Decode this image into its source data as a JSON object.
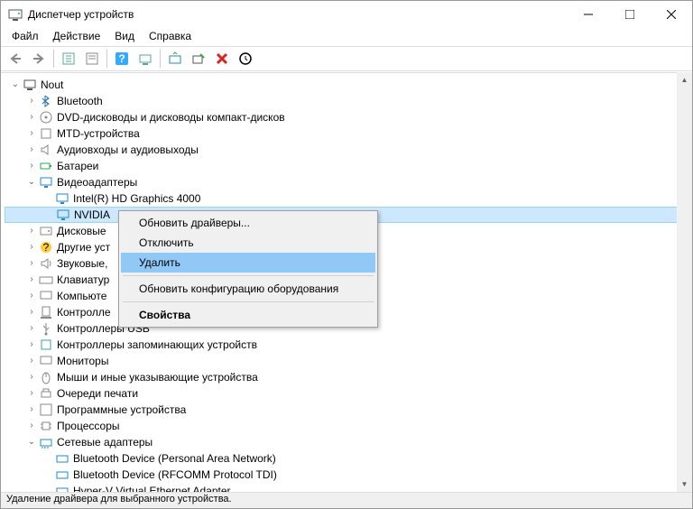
{
  "window": {
    "title": "Диспетчер устройств"
  },
  "menu": {
    "file": "Файл",
    "action": "Действие",
    "view": "Вид",
    "help": "Справка"
  },
  "tree": {
    "root": "Nout",
    "cats": {
      "bluetooth": "Bluetooth",
      "dvd": "DVD-дисководы и дисководы компакт-дисков",
      "mtd": "MTD-устройства",
      "audio": "Аудиовходы и аудиовыходы",
      "battery": "Батареи",
      "video": "Видеоадаптеры",
      "video_intel": "Intel(R) HD Graphics 4000",
      "video_nvidia": "NVIDIA",
      "disk": "Дисковые",
      "other": "Другие уст",
      "sound": "Звуковые,",
      "keyboard": "Клавиатур",
      "computer": "Компьюте",
      "ctrl": "Контролле",
      "usb": "Контроллеры USB",
      "storage": "Контроллеры запоминающих устройств",
      "monitor": "Мониторы",
      "mouse": "Мыши и иные указывающие устройства",
      "print": "Очереди печати",
      "software": "Программные устройства",
      "cpu": "Процессоры",
      "net": "Сетевые адаптеры",
      "net_btpan": "Bluetooth Device (Personal Area Network)",
      "net_btrfc": "Bluetooth Device (RFCOMM Protocol TDI)",
      "net_hv": "Hyper-V Virtual Ethernet Adapter"
    }
  },
  "ctx": {
    "update": "Обновить драйверы...",
    "disable": "Отключить",
    "delete": "Удалить",
    "scan": "Обновить конфигурацию оборудования",
    "props": "Свойства"
  },
  "status": "Удаление драйвера для выбранного устройства."
}
